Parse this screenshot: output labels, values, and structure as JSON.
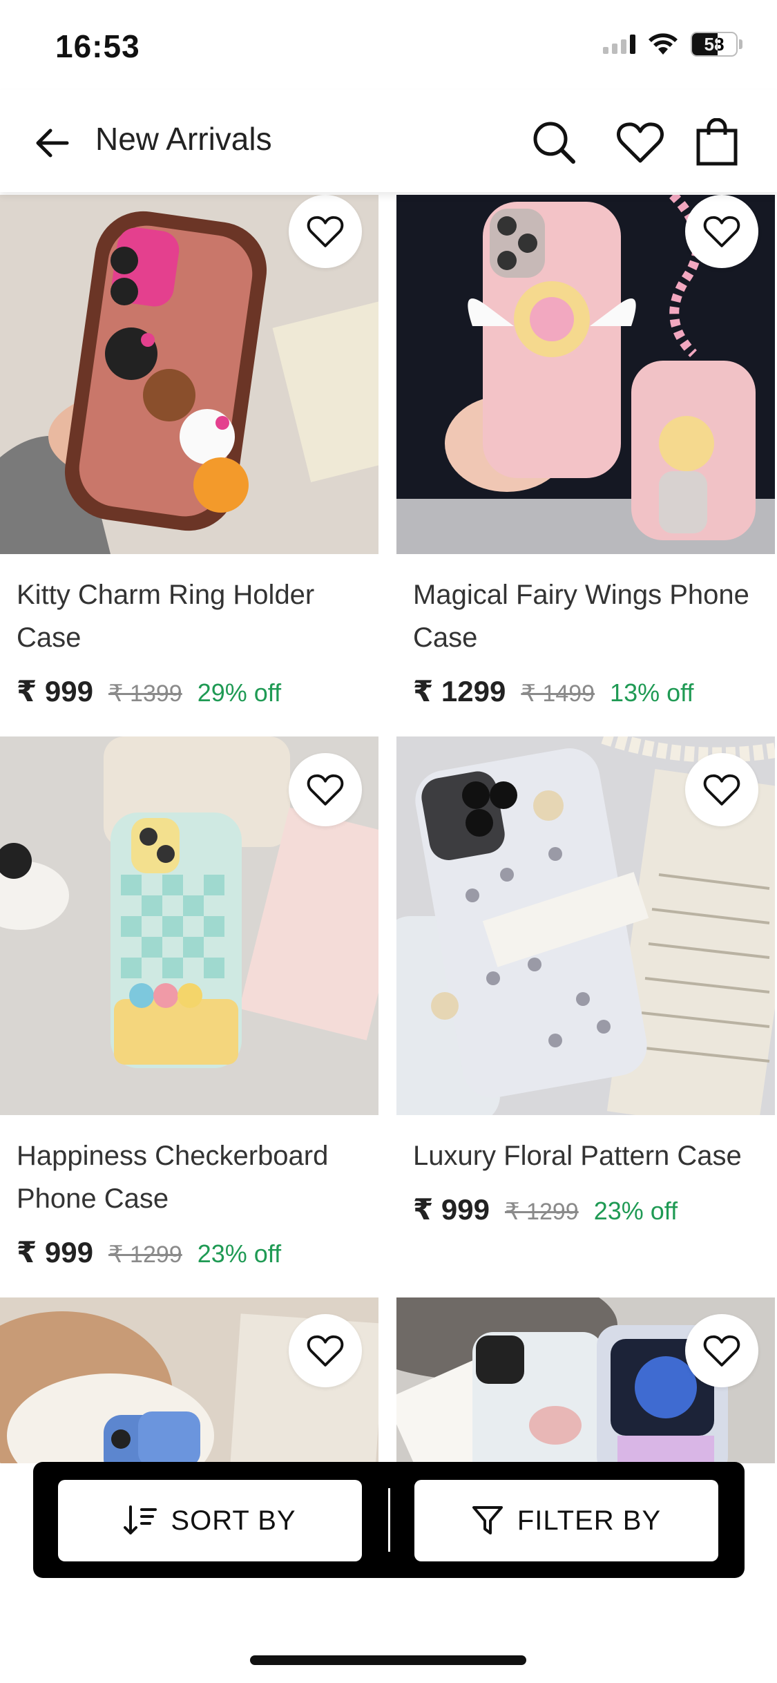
{
  "status_bar": {
    "time": "16:53",
    "battery": "58",
    "icons": [
      "signal-icon",
      "wifi-icon",
      "battery-icon"
    ]
  },
  "header": {
    "title": "New Arrivals",
    "icons": [
      "back-arrow-icon",
      "search-icon",
      "heart-icon",
      "shopping-bag-icon"
    ]
  },
  "products": [
    {
      "name": "Kitty Charm Ring Holder Case",
      "price": "₹ 999",
      "mrp": "₹ 1399",
      "discount": "29% off"
    },
    {
      "name": "Magical Fairy Wings Phone Case",
      "price": "₹ 1299",
      "mrp": "₹ 1499",
      "discount": "13% off"
    },
    {
      "name": "Happiness Checkerboard Phone Case",
      "price": "₹ 999",
      "mrp": "₹ 1299",
      "discount": "23% off"
    },
    {
      "name": "Luxury Floral Pattern Case",
      "price": "₹ 999",
      "mrp": "₹ 1299",
      "discount": "23% off"
    },
    {
      "name": "",
      "price": "",
      "mrp": "",
      "discount": ""
    },
    {
      "name": "",
      "price": "",
      "mrp": "",
      "discount": ""
    }
  ],
  "bottom_bar": {
    "sort_label": "SORT BY",
    "filter_label": "FILTER BY"
  },
  "colors": {
    "discount": "#1f9a54",
    "bar": "#000000",
    "text": "#222222"
  }
}
